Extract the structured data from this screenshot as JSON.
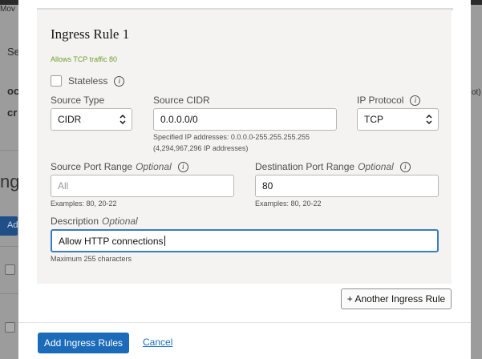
{
  "background": {
    "text_mov": "Mov",
    "text_se": "Se",
    "text_oc": "oc",
    "text_cr": "cr",
    "text_ng": "ng",
    "text_ad": "Ad",
    "text_ot": "ot)"
  },
  "rule": {
    "title": "Ingress Rule 1",
    "subtitle": "Allows TCP traffic 80",
    "stateless_label": "Stateless",
    "stateless_checked": false
  },
  "source_type": {
    "label": "Source Type",
    "value": "CIDR"
  },
  "source_cidr": {
    "label": "Source CIDR",
    "value": "0.0.0.0/0",
    "help_line1": "Specified IP addresses: 0.0.0.0-255.255.255.255",
    "help_line2": "(4,294,967,296 IP addresses)"
  },
  "ip_protocol": {
    "label": "IP Protocol",
    "value": "TCP"
  },
  "source_port": {
    "label": "Source Port Range",
    "optional": "Optional",
    "placeholder": "All",
    "help": "Examples: 80, 20-22"
  },
  "dest_port": {
    "label": "Destination Port Range",
    "optional": "Optional",
    "value": "80",
    "help": "Examples: 80, 20-22"
  },
  "description": {
    "label": "Description",
    "optional": "Optional",
    "value": "Allow HTTP connections",
    "help": "Maximum 255 characters"
  },
  "buttons": {
    "another_rule": "+ Another Ingress Rule",
    "add_rules": "Add Ingress Rules",
    "cancel": "Cancel"
  },
  "colors": {
    "primary": "#1c6bb9",
    "success_text": "#6da12d",
    "focus_border": "#3a7dbf"
  },
  "icons": {
    "info": "info-icon",
    "select_chevron": "chevron-up-down-icon"
  }
}
